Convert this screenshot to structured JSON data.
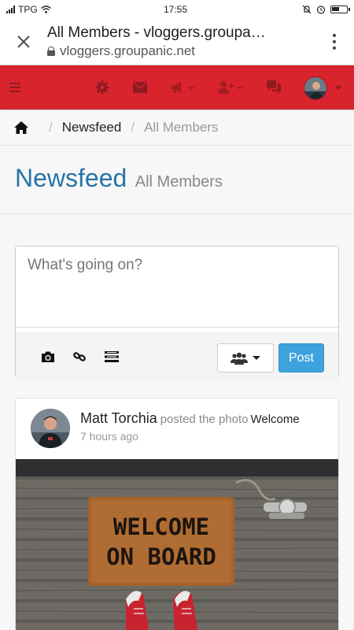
{
  "status_bar": {
    "carrier": "TPG",
    "time": "17:55",
    "icons": [
      "signal-icon",
      "wifi-icon",
      "mute-icon",
      "alarm-icon",
      "battery-icon"
    ]
  },
  "browser": {
    "page_title": "All Members - vloggers.groupa…",
    "domain": "vloggers.groupanic.net",
    "icons": [
      "close-icon",
      "lock-icon",
      "more-vert-icon"
    ]
  },
  "nav": {
    "bg_color": "#d9232d",
    "icons": [
      "menu-icon",
      "gear-icon",
      "mail-icon",
      "bullhorn-icon",
      "add-user-icon",
      "chat-icon",
      "avatar",
      "caret-down-icon"
    ]
  },
  "breadcrumb": {
    "items": [
      "Newsfeed",
      "All Members"
    ]
  },
  "header": {
    "title": "Newsfeed",
    "subtitle": "All Members",
    "title_color": "#2774a8"
  },
  "composer": {
    "placeholder": "What's going on?",
    "post_label": "Post",
    "post_color": "#3ea3dc"
  },
  "feed": [
    {
      "author": "Matt Torchia",
      "action": "posted the photo",
      "object": "Welcome",
      "time": "7 hours ago",
      "photo_text": [
        "WELCOME",
        "ON BOARD"
      ]
    }
  ]
}
